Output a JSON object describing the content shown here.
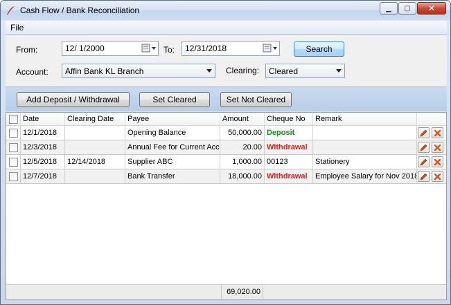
{
  "window": {
    "title": "Cash Flow / Bank Reconciliation"
  },
  "menu": {
    "file": "File"
  },
  "filters": {
    "from_label": "From:",
    "from_value": "12/  1/2000",
    "to_label": "To:",
    "to_value": "12/31/2018",
    "search_label": "Search",
    "account_label": "Account:",
    "account_value": "Affin Bank KL Branch",
    "clearing_label": "Clearing:",
    "clearing_value": "Cleared"
  },
  "actions": {
    "add": "Add Deposit / Withdrawal",
    "set_cleared": "Set Cleared",
    "set_not_cleared": "Set Not Cleared"
  },
  "table": {
    "columns": [
      "Date",
      "Clearing Date",
      "Payee",
      "Amount",
      "Cheque No",
      "Remark"
    ],
    "rows": [
      {
        "date": "12/1/2018",
        "clearing_date": "",
        "payee": "Opening Balance",
        "amount": "50,000.00",
        "cheque": "Deposit",
        "remark": ""
      },
      {
        "date": "12/3/2018",
        "clearing_date": "",
        "payee": "Annual Fee for Current Acc",
        "amount": "20.00",
        "cheque": "Withdrawal",
        "remark": ""
      },
      {
        "date": "12/5/2018",
        "clearing_date": "12/14/2018",
        "payee": "Supplier ABC",
        "amount": "1,000.00",
        "cheque": "00123",
        "remark": "Stationery"
      },
      {
        "date": "12/7/2018",
        "clearing_date": "",
        "payee": "Bank Transfer",
        "amount": "18,000.00",
        "cheque": "Withdrawal",
        "remark": "Employee Salary for Nov 2018"
      }
    ],
    "total": "69,020.00"
  },
  "colors": {
    "deposit": "#1d8a1d",
    "withdrawal": "#e0201b"
  },
  "icons": {
    "title": "feather-icon",
    "edit": "pencil-icon",
    "delete": "delete-x-icon",
    "calendar": "calendar-icon"
  }
}
